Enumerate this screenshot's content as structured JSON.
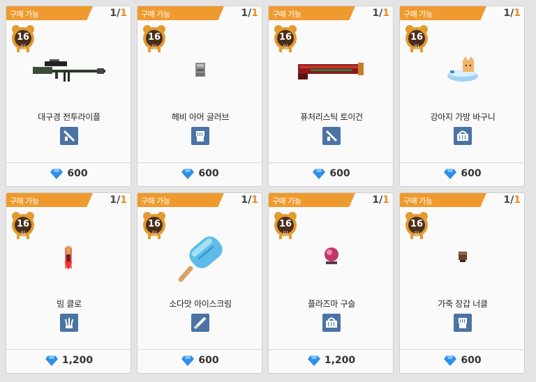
{
  "colors": {
    "tag": "#ef9a2e",
    "accent": "#ef8a1e",
    "category": "#4b73a4",
    "gem": "#2f8ee6"
  },
  "items": [
    {
      "tag": "구매 가능",
      "stock_current": "1",
      "stock_sep": "/",
      "stock_max": "1",
      "days": "16",
      "day_unit": "일",
      "name": "대구경 전투라이플",
      "icon": "sniper-rifle-icon",
      "category": "gun-category-icon",
      "price": "600"
    },
    {
      "tag": "구매 가능",
      "stock_current": "1",
      "stock_sep": "/",
      "stock_max": "1",
      "days": "16",
      "day_unit": "일",
      "name": "헤비 아머 글러브",
      "icon": "armor-glove-icon",
      "category": "glove-category-icon",
      "price": "600"
    },
    {
      "tag": "구매 가능",
      "stock_current": "1",
      "stock_sep": "/",
      "stock_max": "1",
      "days": "16",
      "day_unit": "일",
      "name": "퓨처리스틱 토이건",
      "icon": "toy-gun-icon",
      "category": "gun-category-icon",
      "price": "600"
    },
    {
      "tag": "구매 가능",
      "stock_current": "1",
      "stock_sep": "/",
      "stock_max": "1",
      "days": "16",
      "day_unit": "일",
      "name": "강아지 가방 바구니",
      "icon": "dog-basket-icon",
      "category": "basket-category-icon",
      "price": "600"
    },
    {
      "tag": "구매 가능",
      "stock_current": "1",
      "stock_sep": "/",
      "stock_max": "1",
      "days": "16",
      "day_unit": "일",
      "name": "빔 클로",
      "icon": "beam-claw-icon",
      "category": "claw-category-icon",
      "price": "1,200"
    },
    {
      "tag": "구매 가능",
      "stock_current": "1",
      "stock_sep": "/",
      "stock_max": "1",
      "days": "16",
      "day_unit": "일",
      "name": "소다맛 아이스크림",
      "icon": "popsicle-icon",
      "category": "melee-category-icon",
      "price": "600"
    },
    {
      "tag": "구매 가능",
      "stock_current": "1",
      "stock_sep": "/",
      "stock_max": "1",
      "days": "16",
      "day_unit": "일",
      "name": "플라즈마 구슬",
      "icon": "plasma-orb-icon",
      "category": "basket-category-icon",
      "price": "1,200"
    },
    {
      "tag": "구매 가능",
      "stock_current": "1",
      "stock_sep": "/",
      "stock_max": "1",
      "days": "16",
      "day_unit": "일",
      "name": "가죽 장갑 너클",
      "icon": "leather-knuckle-icon",
      "category": "glove-category-icon",
      "price": "600"
    }
  ]
}
